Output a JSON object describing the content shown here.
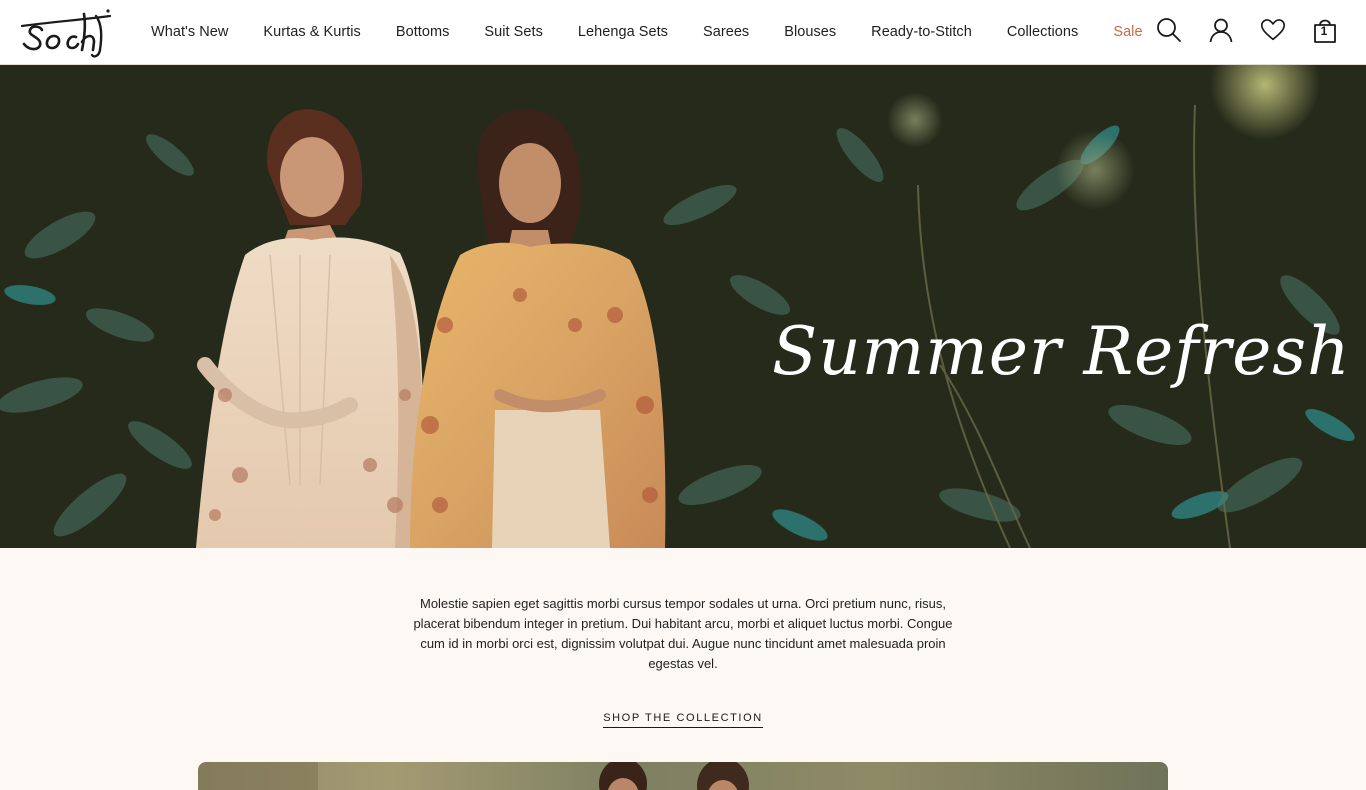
{
  "header": {
    "logo_text": "soch",
    "nav": [
      {
        "label": "What's New"
      },
      {
        "label": "Kurtas & Kurtis"
      },
      {
        "label": "Bottoms"
      },
      {
        "label": "Suit Sets"
      },
      {
        "label": "Lehenga Sets"
      },
      {
        "label": "Sarees"
      },
      {
        "label": "Blouses"
      },
      {
        "label": "Ready-to-Stitch"
      },
      {
        "label": "Collections"
      },
      {
        "label": "Sale"
      }
    ],
    "icons": [
      "search-icon",
      "account-icon",
      "wishlist-icon",
      "cart-icon"
    ],
    "cart_count": "1",
    "sale_color": "#c26a4a"
  },
  "hero": {
    "title": "Summer Refresh"
  },
  "intro": {
    "text": "Molestie sapien eget sagittis morbi cursus tempor sodales ut urna. Orci pretium nunc, risus, placerat bibendum integer in pretium. Dui habitant arcu, morbi et aliquet luctus morbi. Congue cum id in morbi orci est, dignissim volutpat dui. Augue nunc tincidunt amet malesuada proin egestas vel.",
    "cta_label": "SHOP THE COLLECTION"
  },
  "colors": {
    "page_background": "#fdf8f3",
    "hero_background": "#262a1b",
    "accent": "#c26a4a"
  }
}
